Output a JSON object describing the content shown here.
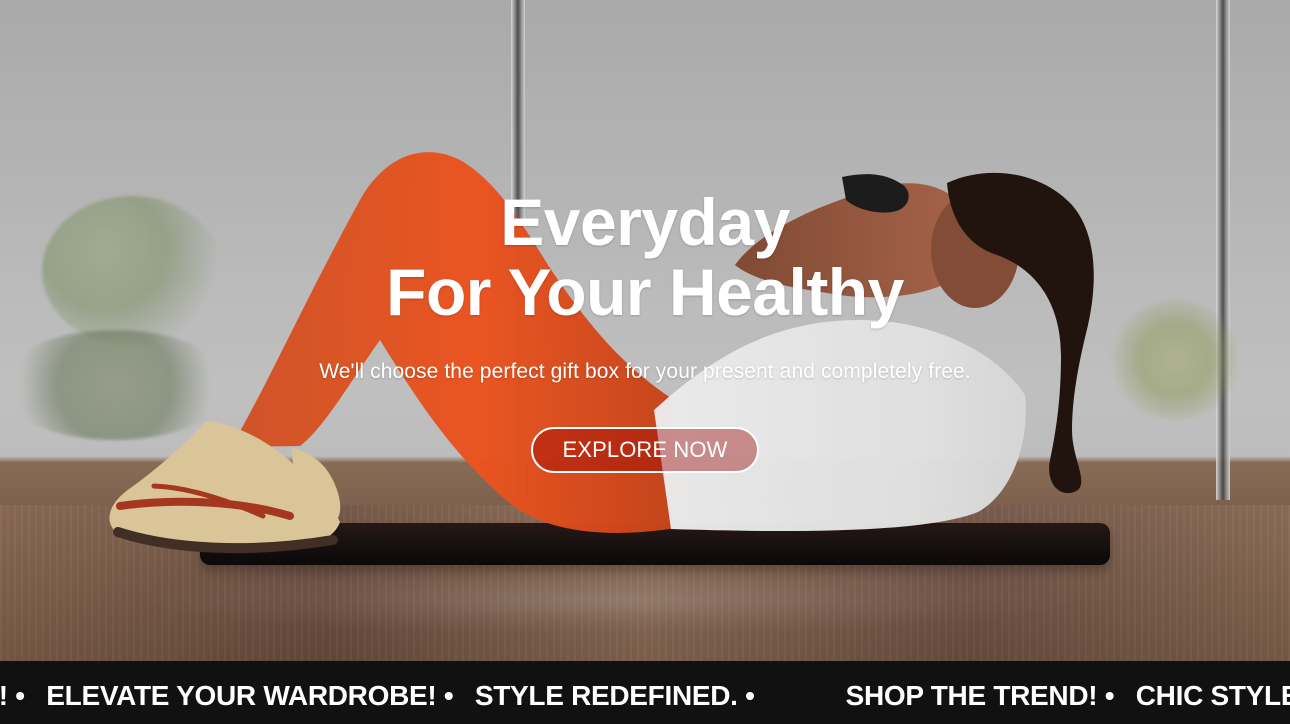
{
  "hero": {
    "title_line_1": "Everyday",
    "title_line_2": "For Your Healthy",
    "subtitle": "We'll choose the perfect gift box for your present and completely free.",
    "cta_label": "EXPLORE NOW"
  },
  "ticker": {
    "items": [
      "T! •",
      "ELEVATE YOUR WARDROBE! •",
      "STYLE REDEFINED. •",
      "SHOP THE TREND! •",
      "CHIC STYLES AV"
    ]
  },
  "colors": {
    "primary_text": "#ffffff",
    "cta_border": "#ffffff",
    "cta_fill": "#960000",
    "ticker_background": "#111111"
  },
  "icons": {
    "hero_image": "person-doing-situps-image"
  }
}
